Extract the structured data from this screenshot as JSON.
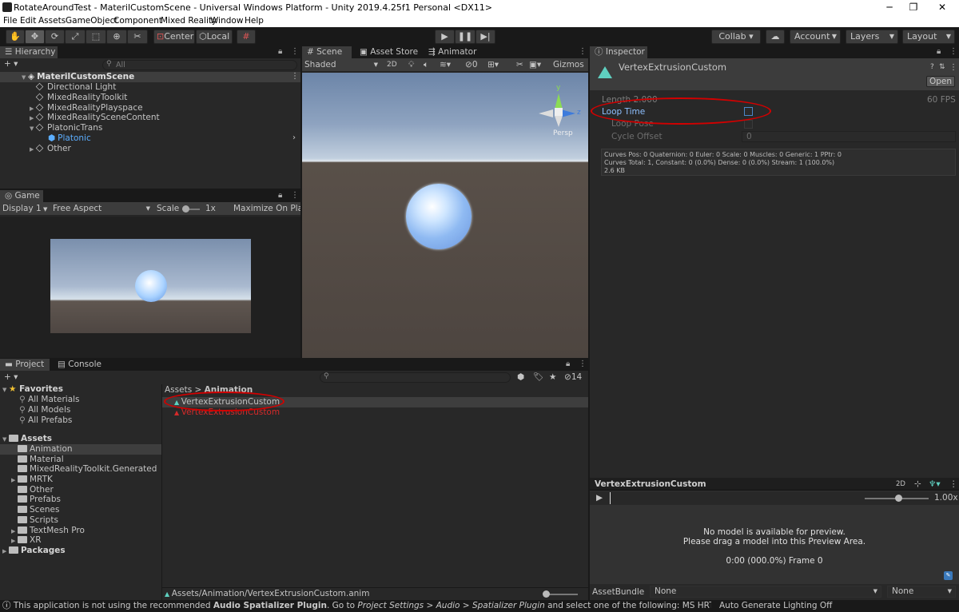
{
  "window": {
    "title": "RotateAroundTest - MaterilCustomScene - Universal Windows Platform - Unity 2019.4.25f1 Personal <DX11>",
    "min_glyph": "─",
    "max_glyph": "❐",
    "close_glyph": "✕"
  },
  "menu": [
    "File",
    "Edit",
    "Assets",
    "GameObject",
    "Component",
    "Mixed Reality",
    "Window",
    "Help"
  ],
  "toolbar": {
    "pivot_label": "Center",
    "space_label": "Local",
    "collab_label": "Collab ▾",
    "account_label": "Account",
    "layers_label": "Layers",
    "layout_label": "Layout"
  },
  "hierarchy": {
    "tab": "Hierarchy",
    "add": "+ ▾",
    "search_placeholder": "All",
    "scene": "MaterilCustomScene",
    "items": [
      {
        "label": "Directional Light",
        "arrow": ""
      },
      {
        "label": "MixedRealityToolkit",
        "arrow": ""
      },
      {
        "label": "MixedRealityPlayspace",
        "arrow": "▶"
      },
      {
        "label": "MixedRealitySceneContent",
        "arrow": "▶"
      },
      {
        "label": "PlatonicTrans",
        "arrow": "▼"
      },
      {
        "label": "Platonic",
        "arrow": ""
      },
      {
        "label": "Other",
        "arrow": "▶"
      }
    ]
  },
  "game": {
    "tab": "Game",
    "display": "Display 1",
    "aspect": "Free Aspect",
    "scale_label": "Scale",
    "scale_value": "1x",
    "maximize": "Maximize On Play"
  },
  "scene": {
    "tabs": [
      "Scene",
      "Asset Store",
      "Animator"
    ],
    "shading": "Shaded",
    "mode_2d": "2D",
    "hidden_count": "0",
    "gizmos": "Gizmos",
    "persp": "Persp",
    "axis_y": "y",
    "axis_z": "z"
  },
  "inspector": {
    "tab": "Inspector",
    "asset_name": "VertexExtrusionCustom",
    "open_button": "Open",
    "length_label": "Length",
    "length_value": "2.000",
    "fps": "60 FPS",
    "loop_time": "Loop Time",
    "loop_pose": "Loop Pose",
    "cycle_offset": "Cycle Offset",
    "cycle_offset_value": "0",
    "info_line1": "Curves Pos: 0 Quaternion: 0 Euler: 0 Scale: 0 Muscles: 0 Generic: 1 PPtr: 0",
    "info_line2": "Curves Total: 1, Constant: 0 (0.0%) Dense: 0 (0.0%) Stream: 1 (100.0%)",
    "info_line3": "2.6 KB"
  },
  "preview": {
    "title": "VertexExtrusionCustom",
    "mode_2d": "2D",
    "speed": "1.00x",
    "msg1": "No model is available for preview.",
    "msg2": "Please drag a model into this Preview Area.",
    "time": "0:00 (000.0%) Frame 0",
    "assetbundle_label": "AssetBundle",
    "assetbundle_value": "None",
    "variant_value": "None"
  },
  "project": {
    "tabs": [
      "Project",
      "Console"
    ],
    "add": "+ ▾",
    "hidden_count": "14",
    "favorites_label": "Favorites",
    "favorites": [
      "All Materials",
      "All Models",
      "All Prefabs"
    ],
    "assets_label": "Assets",
    "folders": [
      {
        "label": "Animation",
        "arrow": ""
      },
      {
        "label": "Material",
        "arrow": ""
      },
      {
        "label": "MixedRealityToolkit.Generated",
        "arrow": ""
      },
      {
        "label": "MRTK",
        "arrow": "▶"
      },
      {
        "label": "Other",
        "arrow": ""
      },
      {
        "label": "Prefabs",
        "arrow": ""
      },
      {
        "label": "Scenes",
        "arrow": ""
      },
      {
        "label": "Scripts",
        "arrow": ""
      },
      {
        "label": "TextMesh Pro",
        "arrow": "▶"
      },
      {
        "label": "XR",
        "arrow": "▶"
      }
    ],
    "packages_label": "Packages",
    "breadcrumb_root": "Assets",
    "breadcrumb_sep": ">",
    "breadcrumb_current": "Animation",
    "files": [
      "VertexExtrusionCustom",
      "VertexExtrusionCustom"
    ],
    "footer_path": "Assets/Animation/VertexExtrusionCustom.anim"
  },
  "status": {
    "text_pre": "This application is not using the recommended ",
    "text_bold": "Audio Spatializer Plugin",
    "text_mid": ". Go to ",
    "text_italic": "Project Settings > Audio > Spatializer Plugin",
    "text_post": " and select one of the following: MS HRTF Spatializer, Microsoft S",
    "right": "Auto Generate Lighting Off"
  },
  "colors": {
    "accent": "#3a79bb",
    "highlight_circle": "#d20000",
    "selected_text": "#5caeff"
  }
}
